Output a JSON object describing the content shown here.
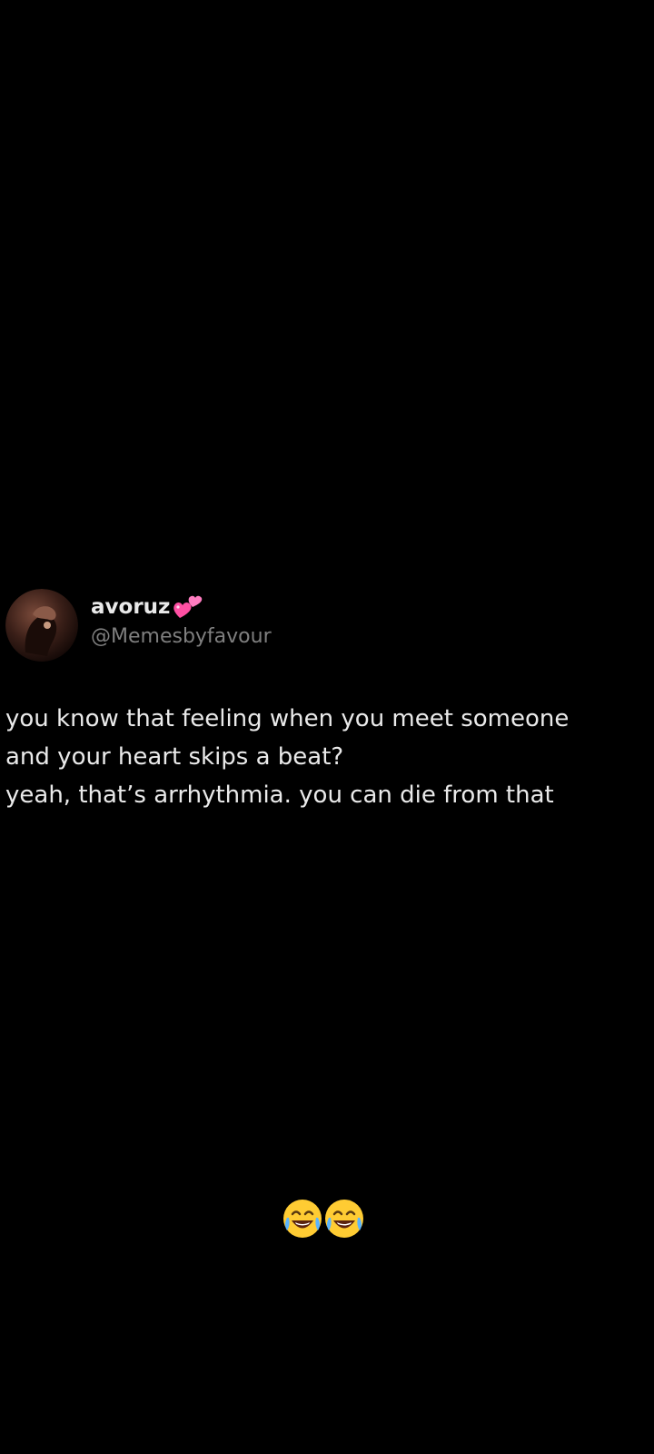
{
  "post": {
    "author": {
      "display_name": "avoruz",
      "name_emoji": "💞",
      "handle": "@Memesbyfavour"
    },
    "text_lines": [
      "you know that feeling when you meet someone",
      "and your heart skips a beat?",
      "yeah, that’s arrhythmia. you can die from that"
    ]
  },
  "reaction": {
    "emoji": "😂😂"
  },
  "colors": {
    "background": "#000000",
    "text": "#eaeaea",
    "handle": "#7f7f7f"
  },
  "icons": {
    "avatar": "avatar-image",
    "name_emoji": "two-hearts-icon",
    "reaction": "face-with-tears-of-joy-icon"
  }
}
